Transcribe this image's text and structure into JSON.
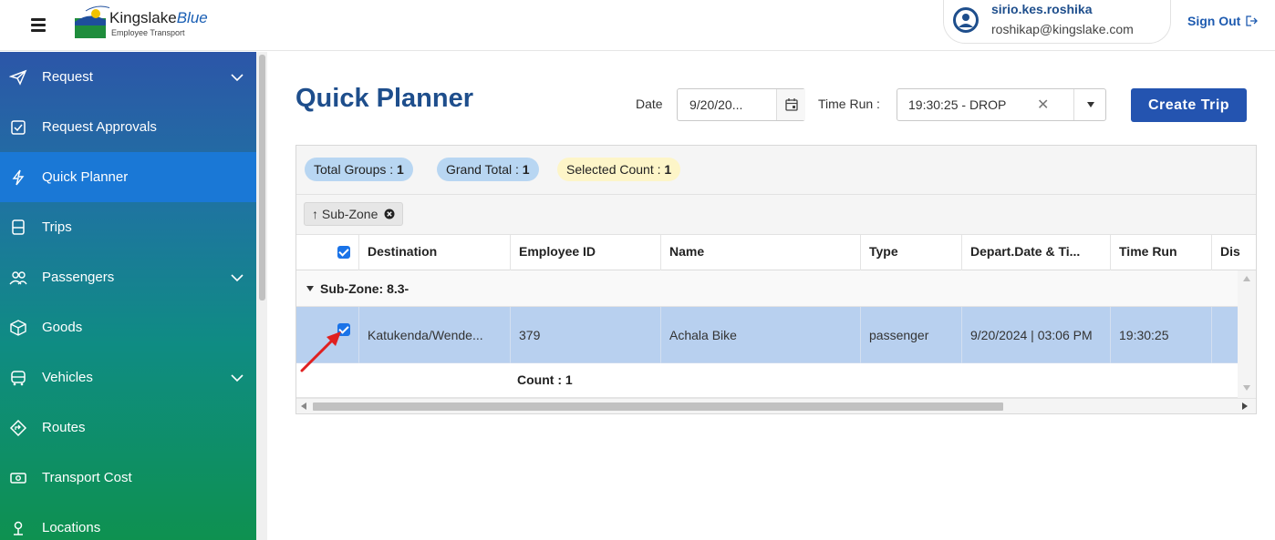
{
  "header": {
    "logo": {
      "brand_main": "Kingslake",
      "brand_accent": "Blue",
      "tagline": "Employee Transport"
    },
    "user": {
      "name": "sirio.kes.roshika",
      "email": "roshikap@kingslake.com"
    },
    "sign_out_label": "Sign Out"
  },
  "sidebar": {
    "items": [
      {
        "label": "Request",
        "icon": "paper-plane-icon",
        "expandable": true
      },
      {
        "label": "Request Approvals",
        "icon": "approval-checklist-icon",
        "expandable": false
      },
      {
        "label": "Quick Planner",
        "icon": "lightning-icon",
        "expandable": false,
        "active": true
      },
      {
        "label": "Trips",
        "icon": "bus-front-icon",
        "expandable": false
      },
      {
        "label": "Passengers",
        "icon": "people-icon",
        "expandable": true
      },
      {
        "label": "Goods",
        "icon": "package-icon",
        "expandable": false
      },
      {
        "label": "Vehicles",
        "icon": "vehicle-icon",
        "expandable": true
      },
      {
        "label": "Routes",
        "icon": "route-icon",
        "expandable": false
      },
      {
        "label": "Transport Cost",
        "icon": "money-icon",
        "expandable": false
      },
      {
        "label": "Locations",
        "icon": "location-pin-icon",
        "expandable": false
      }
    ]
  },
  "main": {
    "title": "Quick Planner",
    "date_label": "Date",
    "date_value": "9/20/20...",
    "time_run_label": "Time Run :",
    "time_run_value": "19:30:25 - DROP",
    "create_trip_label": "Create Trip"
  },
  "grid": {
    "summary": {
      "total_groups_label": "Total Groups :",
      "total_groups_value": "1",
      "grand_total_label": "Grand Total :",
      "grand_total_value": "1",
      "selected_count_label": "Selected Count :",
      "selected_count_value": "1"
    },
    "group_chip": {
      "arrow": "↑",
      "label": "Sub-Zone"
    },
    "columns": [
      "Destination",
      "Employee ID",
      "Name",
      "Type",
      "Depart.Date & Ti...",
      "Time Run",
      "Dis"
    ],
    "group_row_label": "Sub-Zone: 8.3-",
    "rows": [
      {
        "destination": "Katukenda/Wende...",
        "employee_id": "379",
        "name": "Achala Bike",
        "type": "passenger",
        "depart": "9/20/2024 | 03:06 PM",
        "time_run": "19:30:25",
        "selected": true
      }
    ],
    "count_label": "Count : 1"
  },
  "colors": {
    "primary": "#2454b0",
    "title": "#1e4e8c",
    "active_nav": "#1a78d6",
    "selected_row": "#b8d0ef",
    "pill_blue": "#b8d6f2",
    "pill_yellow": "#fdf5c8",
    "annotation_arrow": "#e02020"
  }
}
